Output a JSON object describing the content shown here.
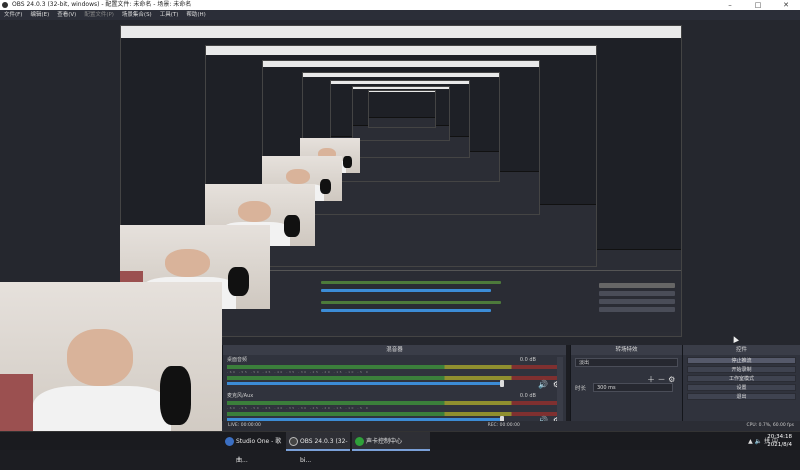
{
  "window": {
    "title": "OBS 24.0.3 (32-bit, windows) - 配置文件: 未命名 - 场景: 未命名"
  },
  "menu": [
    {
      "label": "文件(F)",
      "disabled": false
    },
    {
      "label": "编辑(E)",
      "disabled": false
    },
    {
      "label": "查看(V)",
      "disabled": false
    },
    {
      "label": "配置文件(P)",
      "disabled": true
    },
    {
      "label": "场景集合(S)",
      "disabled": false
    },
    {
      "label": "工具(T)",
      "disabled": false
    },
    {
      "label": "帮助(H)",
      "disabled": false
    }
  ],
  "mixer": {
    "title": "混音器",
    "tracks": [
      {
        "name": "桌面音频",
        "db": "0.0 dB"
      },
      {
        "name": "麦克风/Aux",
        "db": "0.0 dB"
      }
    ],
    "tick_labels": "-60 -55 -50 -45 -40 -35 -30 -25 -20 -15 -10 -5 0"
  },
  "transitions": {
    "title": "转场特效",
    "selected": "淡出",
    "duration_label": "时长",
    "duration_value": "300 ms"
  },
  "controls": {
    "title": "控件",
    "buttons": [
      "停止推流",
      "开始录制",
      "工作室模式",
      "设置",
      "退出"
    ]
  },
  "status": {
    "live": "LIVE: 00:00:00",
    "rec": "REC: 00:00:00",
    "cpu": "CPU: 0.7%, 60.00 fps"
  },
  "taskbar": {
    "items": [
      {
        "label": "Studio One - 歌曲...",
        "color": "#3b6fc2"
      },
      {
        "label": "OBS 24.0.3 (32-bi...",
        "color": "#444444"
      },
      {
        "label": "声卡控制中心",
        "color": "#2fa03a"
      }
    ],
    "tray": "拼 中",
    "time": "20:34:18",
    "date": "2021/8/4"
  }
}
